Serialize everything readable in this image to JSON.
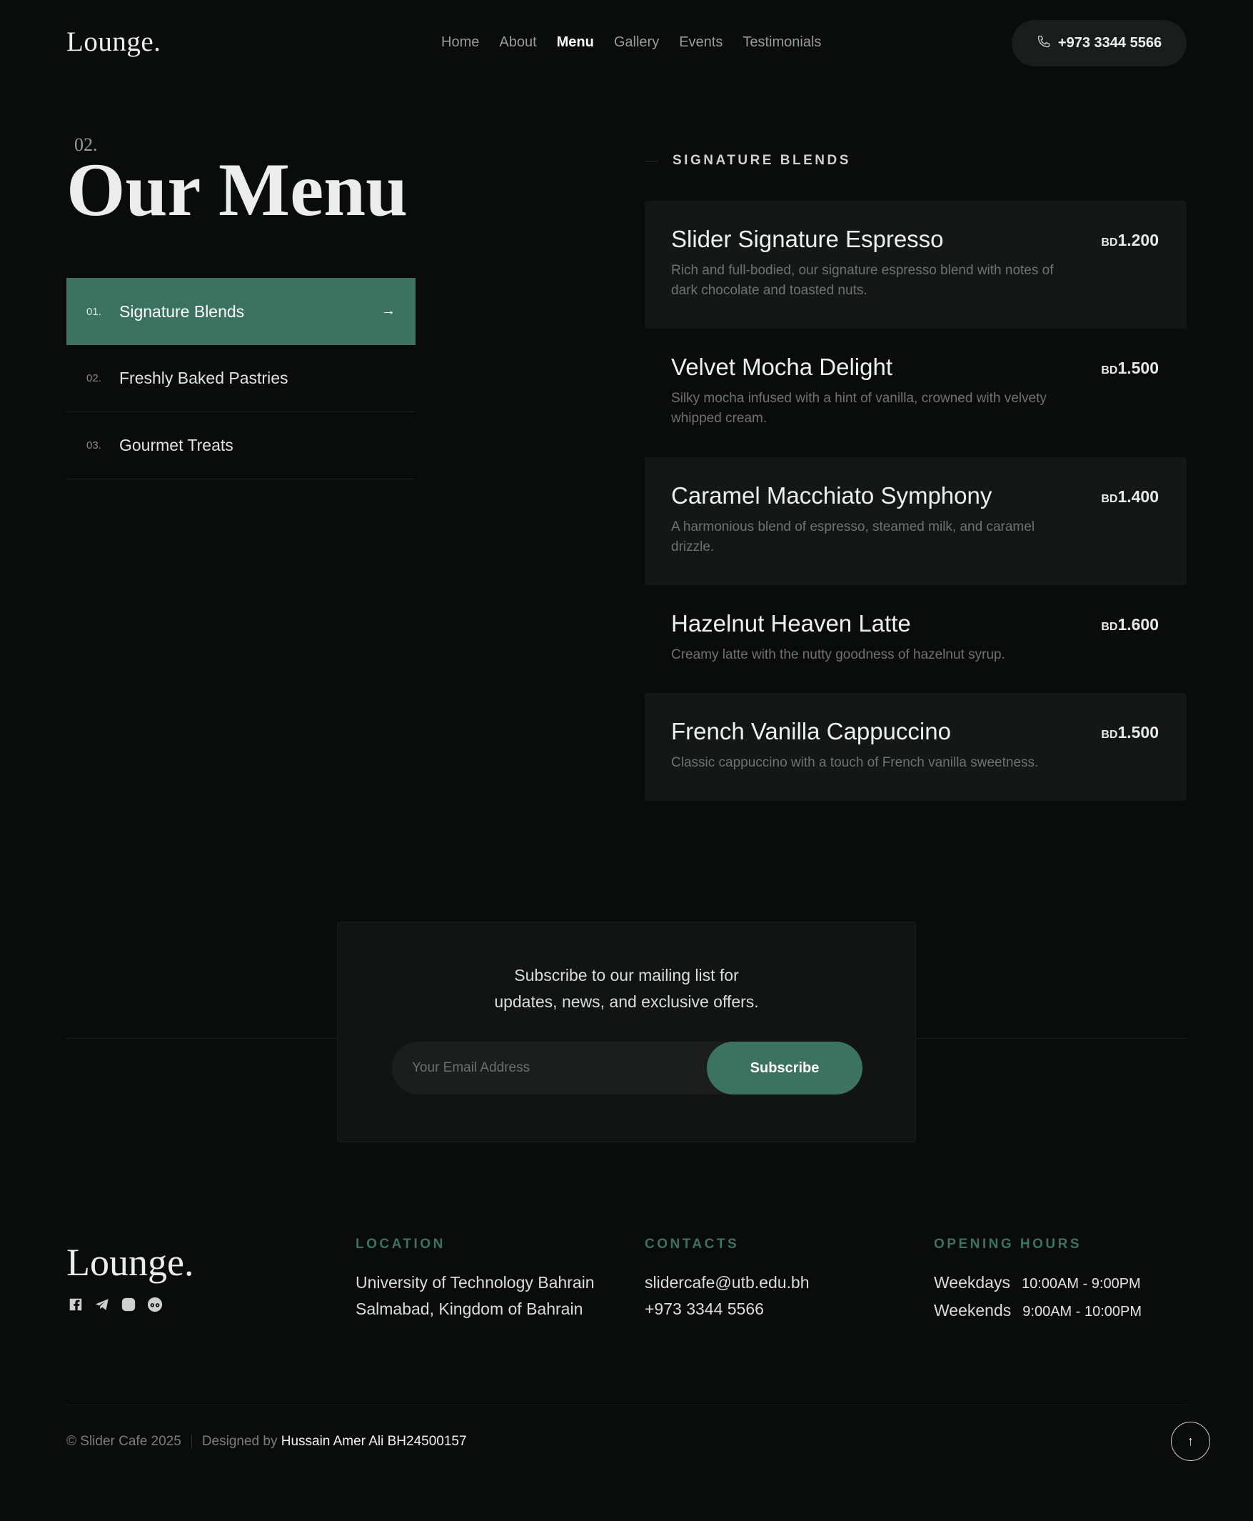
{
  "brand": {
    "logo": "Lounge."
  },
  "nav": {
    "items": [
      "Home",
      "About",
      "Menu",
      "Gallery",
      "Events",
      "Testimonials"
    ],
    "active": "Menu"
  },
  "header": {
    "phone": "+973 3344 5566"
  },
  "menu": {
    "section_number": "02.",
    "title": "Our Menu",
    "categories": [
      {
        "num": "01.",
        "label": "Signature Blends"
      },
      {
        "num": "02.",
        "label": "Freshly Baked Pastries"
      },
      {
        "num": "03.",
        "label": "Gourmet Treats"
      }
    ],
    "active_category": "Signature Blends",
    "current_heading": "SIGNATURE BLENDS",
    "items": [
      {
        "name": "Slider Signature Espresso",
        "desc": "Rich and full-bodied, our signature espresso blend with notes of dark chocolate and toasted nuts.",
        "currency": "BD",
        "price": "1.200"
      },
      {
        "name": "Velvet Mocha Delight",
        "desc": "Silky mocha infused with a hint of vanilla, crowned with velvety whipped cream.",
        "currency": "BD",
        "price": "1.500"
      },
      {
        "name": "Caramel Macchiato Symphony",
        "desc": "A harmonious blend of espresso, steamed milk, and caramel drizzle.",
        "currency": "BD",
        "price": "1.400"
      },
      {
        "name": "Hazelnut Heaven Latte",
        "desc": "Creamy latte with the nutty goodness of hazelnut syrup.",
        "currency": "BD",
        "price": "1.600"
      },
      {
        "name": "French Vanilla Cappuccino",
        "desc": "Classic cappuccino with a touch of French vanilla sweetness.",
        "currency": "BD",
        "price": "1.500"
      }
    ]
  },
  "subscribe": {
    "text_line1": "Subscribe to our mailing list for",
    "text_line2": "updates, news, and exclusive offers.",
    "placeholder": "Your Email Address",
    "button": "Subscribe"
  },
  "footer": {
    "logo": "Lounge.",
    "socials": [
      "facebook-icon",
      "telegram-icon",
      "instagram-icon",
      "tripadvisor-icon"
    ],
    "location": {
      "heading": "LOCATION",
      "line1": "University of Technology Bahrain",
      "line2": "Salmabad, Kingdom of Bahrain"
    },
    "contacts": {
      "heading": "CONTACTS",
      "email": "slidercafe@utb.edu.bh",
      "phone": "+973 3344 5566"
    },
    "hours": {
      "heading": "OPENING HOURS",
      "weekdays_label": "Weekdays",
      "weekdays_time": "10:00AM - 9:00PM",
      "weekends_label": "Weekends",
      "weekends_time": "9:00AM - 10:00PM"
    },
    "copyright": "© Slider Cafe 2025",
    "designed_by_label": "Designed by",
    "designer": "Hussain Amer Ali BH24500157",
    "back_to_top": "↑"
  },
  "colors": {
    "accent": "#3b7360",
    "background": "#0a0b0b",
    "card": "#151616"
  }
}
